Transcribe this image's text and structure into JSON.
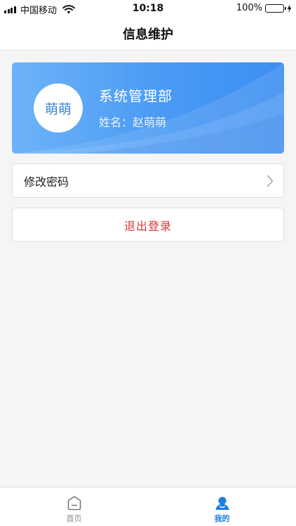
{
  "status_bar": {
    "carrier": "中国移动",
    "time": "10:18",
    "battery": "100%"
  },
  "nav": {
    "title": "信息维护"
  },
  "profile": {
    "avatar_text": "萌萌",
    "department": "系统管理部",
    "name_line": "姓名：赵萌萌"
  },
  "actions": {
    "change_password": "修改密码",
    "logout": "退出登录"
  },
  "tabs": [
    {
      "label": "首页",
      "icon": "home-icon",
      "active": false
    },
    {
      "label": "我的",
      "icon": "user-icon",
      "active": true
    }
  ],
  "colors": {
    "accent": "#1d7de3",
    "card_gradient_start": "#6db3f8",
    "card_gradient_end": "#3d8ef2",
    "logout_text": "#d23a3a",
    "battery": "#4cd964"
  }
}
